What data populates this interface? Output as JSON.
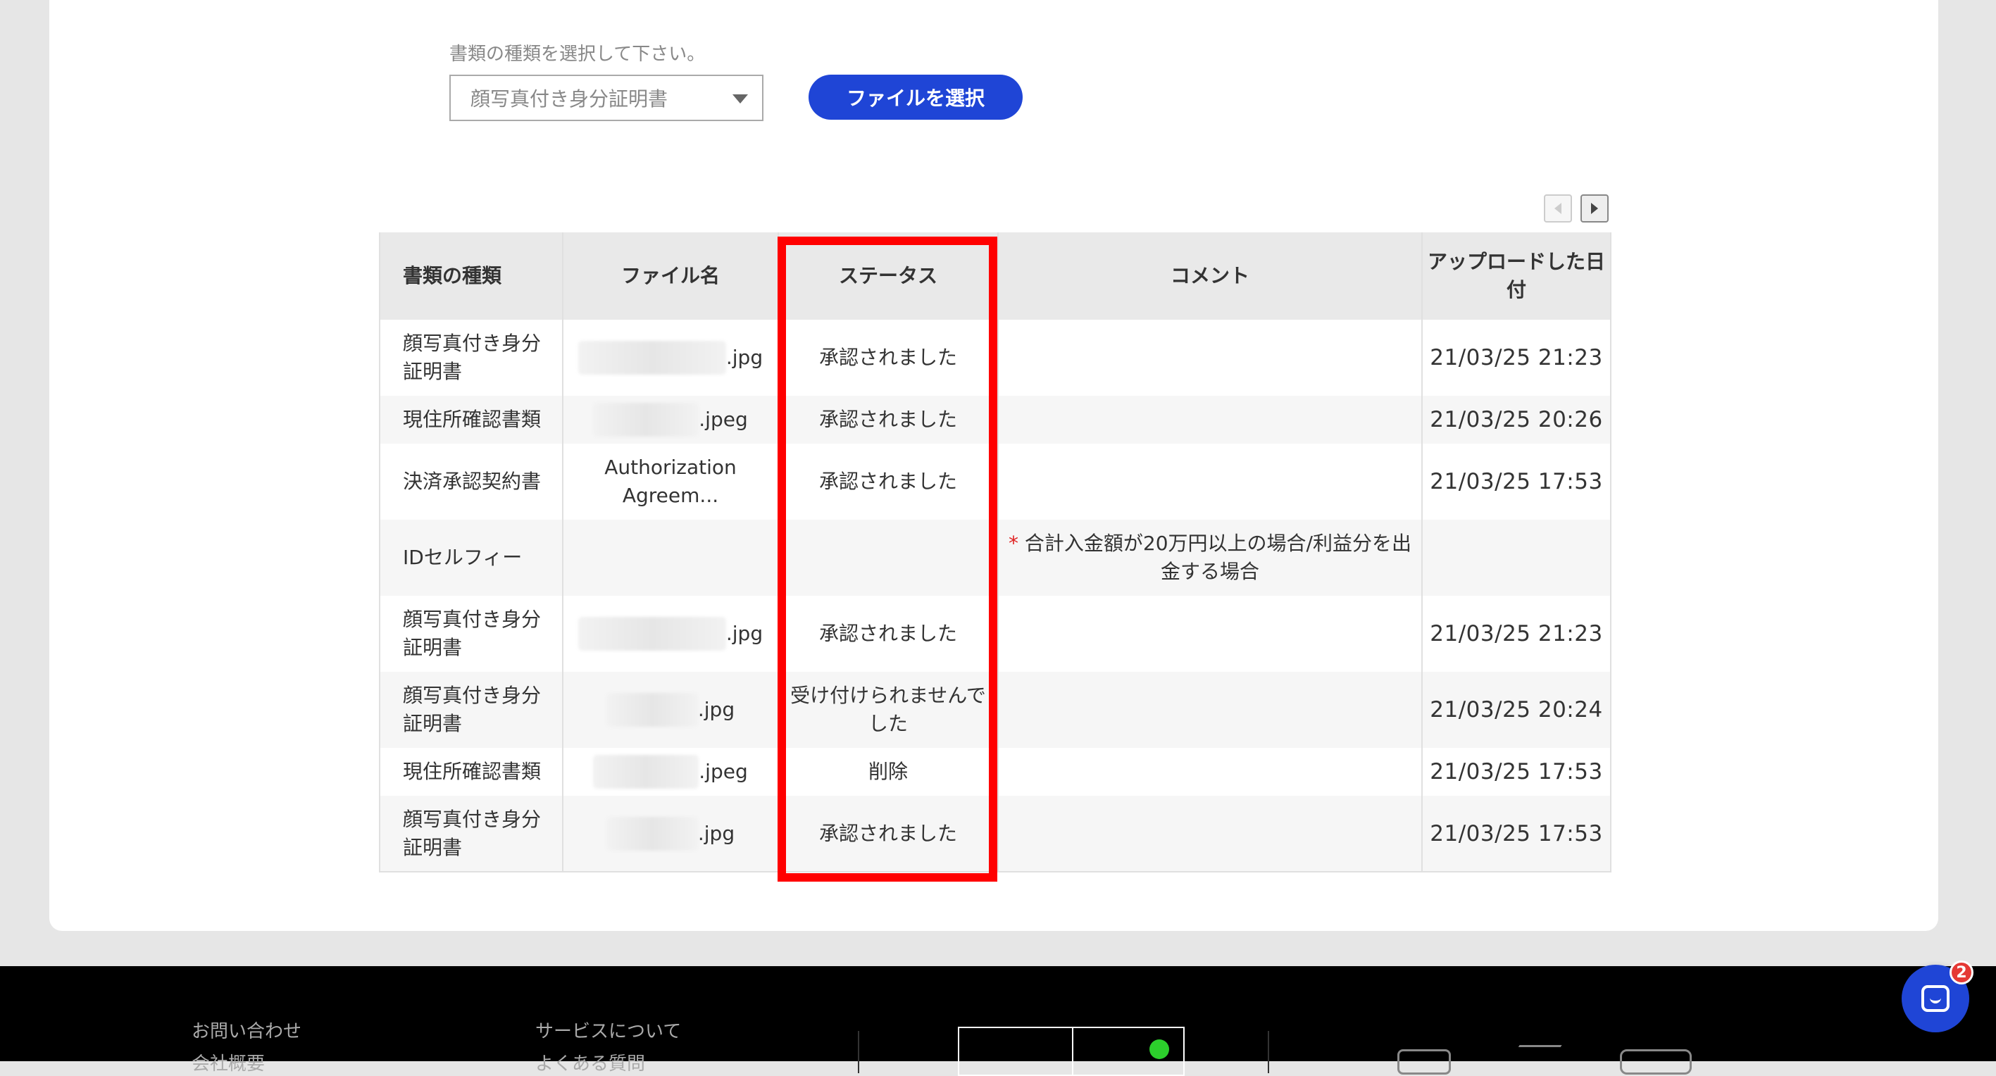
{
  "upload": {
    "label": "書類の種類を選択して下さい。",
    "selected_type": "顔写真付き身分証明書",
    "file_button": "ファイルを選択"
  },
  "table": {
    "headers": [
      "書類の種類",
      "ファイル名",
      "ステータス",
      "コメント",
      "アップロードした日付"
    ],
    "rows": [
      {
        "type": "顔写真付き身分証明書",
        "file": ".jpg",
        "status": "承認されました",
        "comment": "",
        "date": "21/03/25 21:23"
      },
      {
        "type": "現住所確認書類",
        "file": ".jpeg",
        "status": "承認されました",
        "comment": "",
        "date": "21/03/25 20:26"
      },
      {
        "type": "決済承認契約書",
        "file": "Authorization Agreem...",
        "status": "承認されました",
        "comment": "",
        "date": "21/03/25 17:53"
      },
      {
        "type": "IDセルフィー",
        "file": "",
        "status": "",
        "comment_required": "*",
        "comment": "合計入金額が20万円以上の場合/利益分を出金する場合",
        "date": ""
      },
      {
        "type": "顔写真付き身分証明書",
        "file": ".jpg",
        "status": "承認されました",
        "comment": "",
        "date": "21/03/25 21:23"
      },
      {
        "type": "顔写真付き身分証明書",
        "file": ".jpg",
        "status": "受け付けられませんでした",
        "comment": "",
        "date": "21/03/25 20:24"
      },
      {
        "type": "現住所確認書類",
        "file": ".jpeg",
        "status": "削除",
        "comment": "",
        "date": "21/03/25 17:53"
      },
      {
        "type": "顔写真付き身分証明書",
        "file": ".jpg",
        "status": "承認されました",
        "comment": "",
        "date": "21/03/25 17:53"
      }
    ]
  },
  "footer": {
    "links_col1": [
      "お問い合わせ",
      "会社概要"
    ],
    "links_col2": [
      "サービスについて",
      "よくある質問"
    ]
  },
  "chat": {
    "badge": "2"
  },
  "colors": {
    "accent": "#1f45d6",
    "highlight": "#ff0000",
    "badge": "#e53935"
  }
}
